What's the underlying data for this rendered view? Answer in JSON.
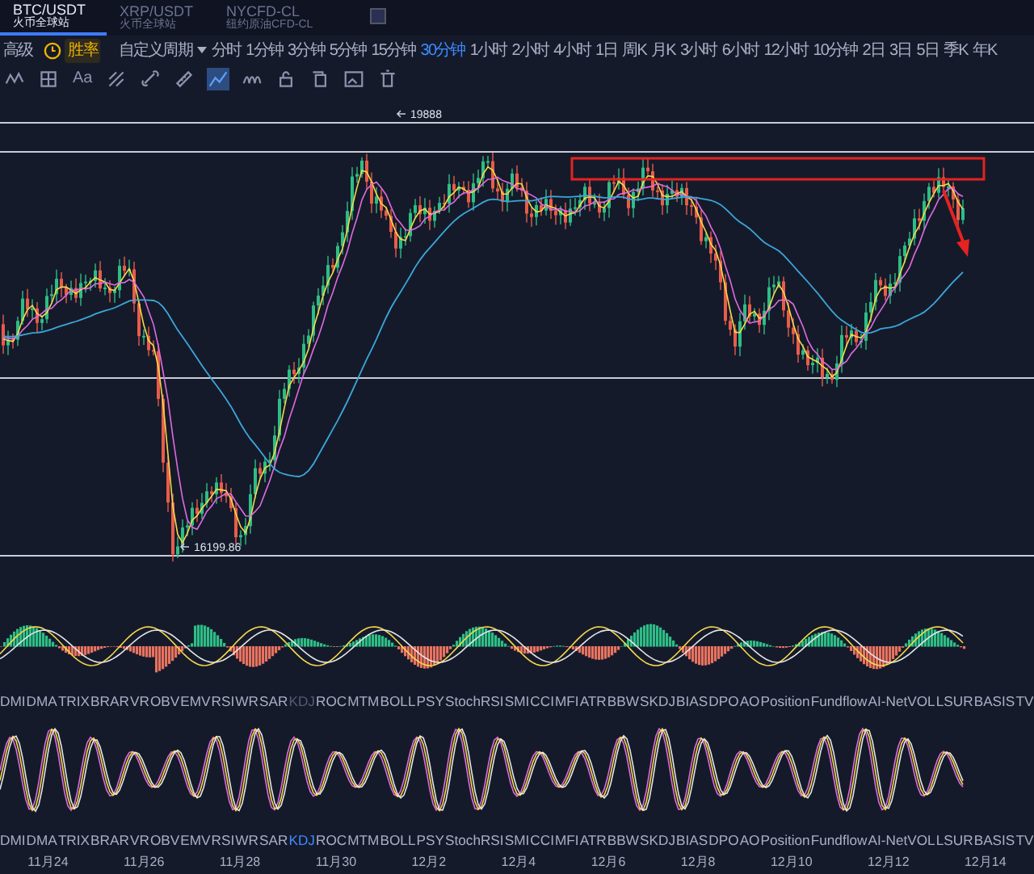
{
  "tabs": [
    {
      "symbol": "BTC/USDT",
      "subtitle": "火币全球站",
      "selected": true
    },
    {
      "symbol": "XRP/USDT",
      "subtitle": "火币全球站",
      "selected": false
    },
    {
      "symbol": "NYCFD-CL",
      "subtitle": "纽约原油CFD-CL",
      "selected": false
    }
  ],
  "toolbar": {
    "advanced": "高级",
    "win_rate": "胜率",
    "custom_period": "自定义周期",
    "timeframes": [
      {
        "label": "分时",
        "selected": false
      },
      {
        "label": "1分钟",
        "selected": false
      },
      {
        "label": "3分钟",
        "selected": false
      },
      {
        "label": "5分钟",
        "selected": false
      },
      {
        "label": "15分钟",
        "selected": false
      },
      {
        "label": "30分钟",
        "selected": true
      },
      {
        "label": "1小时",
        "selected": false
      },
      {
        "label": "2小时",
        "selected": false
      },
      {
        "label": "4小时",
        "selected": false
      },
      {
        "label": "1日",
        "selected": false
      },
      {
        "label": "周K",
        "selected": false
      },
      {
        "label": "月K",
        "selected": false
      },
      {
        "label": "3小时",
        "selected": false
      },
      {
        "label": "6小时",
        "selected": false
      },
      {
        "label": "12小时",
        "selected": false
      },
      {
        "label": "10分钟",
        "selected": false
      },
      {
        "label": "2日",
        "selected": false
      },
      {
        "label": "3日",
        "selected": false
      },
      {
        "label": "5日",
        "selected": false
      },
      {
        "label": "季K",
        "selected": false
      },
      {
        "label": "年K",
        "selected": false
      }
    ]
  },
  "drawing_tools": [
    {
      "kind": "zigzag",
      "selected": false
    },
    {
      "kind": "grid",
      "selected": false
    },
    {
      "kind": "text",
      "label": "Aa",
      "selected": false
    },
    {
      "kind": "pattern",
      "selected": false
    },
    {
      "kind": "link",
      "selected": false
    },
    {
      "kind": "ruler",
      "selected": false
    },
    {
      "kind": "mountain",
      "selected": true
    },
    {
      "kind": "waves",
      "selected": false
    },
    {
      "kind": "lock",
      "selected": false
    },
    {
      "kind": "copy",
      "selected": false
    },
    {
      "kind": "image",
      "selected": false
    },
    {
      "kind": "trash",
      "selected": false
    }
  ],
  "chart": {
    "high_label": "19888",
    "low_label": "16199.86"
  },
  "indicators_top": [
    {
      "label": "DMI",
      "disabled": false
    },
    {
      "label": "DMA",
      "disabled": false
    },
    {
      "label": "TRIX",
      "disabled": false
    },
    {
      "label": "BRAR",
      "disabled": false
    },
    {
      "label": "VR",
      "disabled": false
    },
    {
      "label": "OBV",
      "disabled": false
    },
    {
      "label": "EMV",
      "disabled": false
    },
    {
      "label": "RSI",
      "disabled": false
    },
    {
      "label": "WR",
      "disabled": false
    },
    {
      "label": "SAR",
      "disabled": false
    },
    {
      "label": "KDJ",
      "disabled": true
    },
    {
      "label": "ROC",
      "disabled": false
    },
    {
      "label": "MTM",
      "disabled": false
    },
    {
      "label": "BOLL",
      "disabled": false
    },
    {
      "label": "PSY",
      "disabled": false
    },
    {
      "label": "StochRSI",
      "disabled": false
    },
    {
      "label": "SMI",
      "disabled": false
    },
    {
      "label": "CCI",
      "disabled": false
    },
    {
      "label": "MFI",
      "disabled": false
    },
    {
      "label": "ATR",
      "disabled": false
    },
    {
      "label": "BBW",
      "disabled": false
    },
    {
      "label": "SKDJ",
      "disabled": false
    },
    {
      "label": "BIAS",
      "disabled": false
    },
    {
      "label": "DPO",
      "disabled": false
    },
    {
      "label": "AO",
      "disabled": false
    },
    {
      "label": "Position",
      "disabled": false
    },
    {
      "label": "Fundflow",
      "disabled": false
    },
    {
      "label": "AI-NetVOL",
      "disabled": false
    },
    {
      "label": "LSUR",
      "disabled": false
    },
    {
      "label": "BASIS",
      "disabled": false
    },
    {
      "label": "TV",
      "disabled": false
    }
  ],
  "indicators_bottom": [
    {
      "label": "DMI",
      "selected": false
    },
    {
      "label": "DMA",
      "selected": false
    },
    {
      "label": "TRIX",
      "selected": false
    },
    {
      "label": "BRAR",
      "selected": false
    },
    {
      "label": "VR",
      "selected": false
    },
    {
      "label": "OBV",
      "selected": false
    },
    {
      "label": "EMV",
      "selected": false
    },
    {
      "label": "RSI",
      "selected": false
    },
    {
      "label": "WR",
      "selected": false
    },
    {
      "label": "SAR",
      "selected": false
    },
    {
      "label": "KDJ",
      "selected": true
    },
    {
      "label": "ROC",
      "selected": false
    },
    {
      "label": "MTM",
      "selected": false
    },
    {
      "label": "BOLL",
      "selected": false
    },
    {
      "label": "PSY",
      "selected": false
    },
    {
      "label": "StochRSI",
      "selected": false
    },
    {
      "label": "SMI",
      "selected": false
    },
    {
      "label": "CCI",
      "selected": false
    },
    {
      "label": "MFI",
      "selected": false
    },
    {
      "label": "ATR",
      "selected": false
    },
    {
      "label": "BBW",
      "selected": false
    },
    {
      "label": "SKDJ",
      "selected": false
    },
    {
      "label": "BIAS",
      "selected": false
    },
    {
      "label": "DPO",
      "selected": false
    },
    {
      "label": "AO",
      "selected": false
    },
    {
      "label": "Position",
      "selected": false
    },
    {
      "label": "Fundflow",
      "selected": false
    },
    {
      "label": "AI-NetVOL",
      "selected": false
    },
    {
      "label": "LSUR",
      "selected": false
    },
    {
      "label": "BASIS",
      "selected": false
    },
    {
      "label": "TV",
      "selected": false
    }
  ],
  "dates": [
    "11月24",
    "11月26",
    "11月28",
    "11月30",
    "12月2",
    "12月4",
    "12月6",
    "12月8",
    "12月10",
    "12月12",
    "12月14"
  ]
}
